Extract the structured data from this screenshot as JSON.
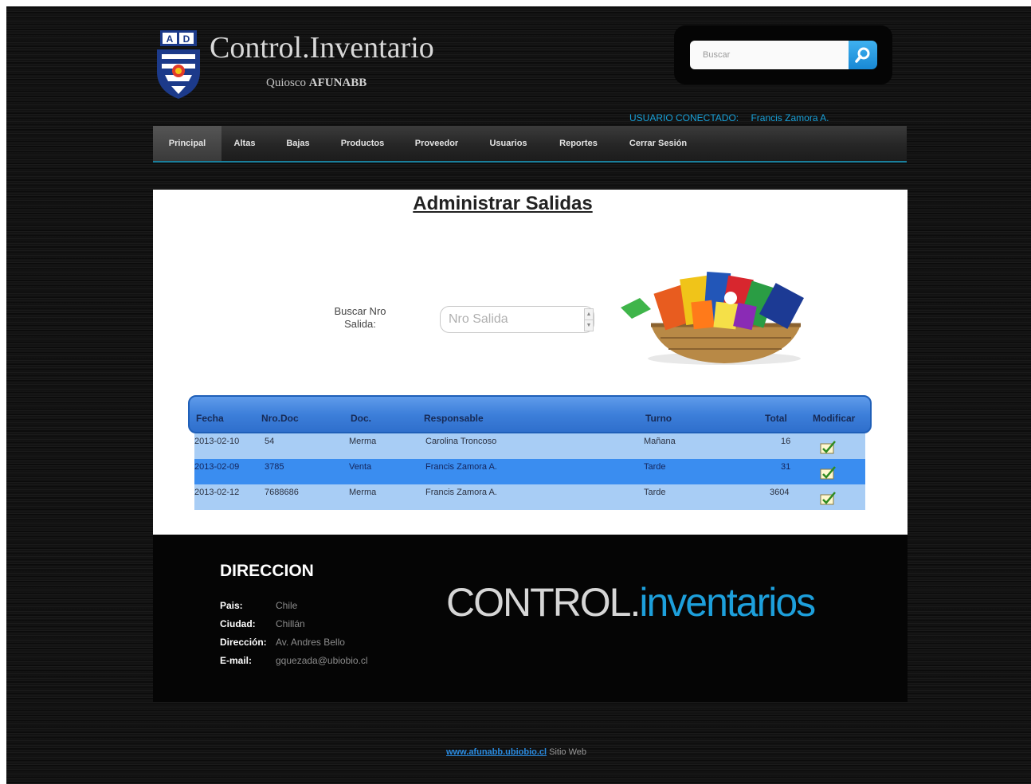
{
  "header": {
    "title": "Control.Inventario",
    "subtitle_prefix": "Quiosco",
    "subtitle_brand": "AFUNABB",
    "search_placeholder": "Buscar",
    "user_label": "USUARIO CONECTADO:",
    "user_name": "Francis Zamora A."
  },
  "nav": {
    "items": [
      {
        "label": "Principal"
      },
      {
        "label": "Altas"
      },
      {
        "label": "Bajas"
      },
      {
        "label": "Productos"
      },
      {
        "label": "Proveedor"
      },
      {
        "label": "Usuarios"
      },
      {
        "label": "Reportes"
      },
      {
        "label": "Cerrar Sesión"
      }
    ],
    "active": "Principal"
  },
  "main": {
    "page_title": "Administrar Salidas",
    "filter_label": "Buscar Nro Salida:",
    "filter_placeholder": "Nro Salida"
  },
  "table": {
    "columns": [
      "Fecha",
      "Nro.Doc",
      "Doc.",
      "Responsable",
      "Turno",
      "Total",
      "Modificar"
    ],
    "rows": [
      {
        "fecha": "2013-02-10",
        "nro_doc": "54",
        "doc": "Merma",
        "responsable": "Carolina Troncoso",
        "turno": "Mañana",
        "total": "16"
      },
      {
        "fecha": "2013-02-09",
        "nro_doc": "3785",
        "doc": "Venta",
        "responsable": "Francis Zamora A.",
        "turno": "Tarde",
        "total": "31"
      },
      {
        "fecha": "2013-02-12",
        "nro_doc": "7688686",
        "doc": "Merma",
        "responsable": "Francis Zamora A.",
        "turno": "Tarde",
        "total": "3604"
      }
    ]
  },
  "footer": {
    "heading": "DIRECCION",
    "fields": [
      {
        "key": "Pais:",
        "value": "Chile"
      },
      {
        "key": "Ciudad:",
        "value": "Chillán"
      },
      {
        "key": "Dirección:",
        "value": "Av. Andres Bello"
      },
      {
        "key": "E-mail:",
        "value": "gquezada@ubiobio.cl"
      }
    ],
    "brand_part1": "CONTROL.",
    "brand_part2": "inventarios"
  },
  "bottom": {
    "link_text": "www.afunabb.ubiobio.cl",
    "suffix": "Sitio Web"
  },
  "colors": {
    "accent": "#1d9fdb",
    "table_header": "#3d7fda",
    "row_light": "#a8cdf5",
    "row_dark": "#3a8df0"
  }
}
